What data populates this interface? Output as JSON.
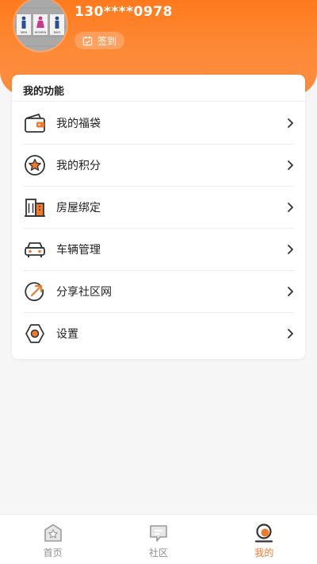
{
  "header": {
    "phone": "130****0978",
    "signin_label": "签到",
    "avatar_signs": [
      "MEN",
      "WOMEN",
      "DIKO"
    ]
  },
  "functions": {
    "title": "我的功能",
    "items": [
      {
        "label": "我的福袋",
        "icon": "wallet-icon"
      },
      {
        "label": "我的积分",
        "icon": "star-badge-icon"
      },
      {
        "label": "房屋绑定",
        "icon": "building-icon"
      },
      {
        "label": "车辆管理",
        "icon": "car-icon"
      },
      {
        "label": "分享社区网",
        "icon": "share-icon"
      },
      {
        "label": "设置",
        "icon": "settings-icon"
      }
    ]
  },
  "nav": {
    "items": [
      {
        "label": "首页",
        "icon": "home-icon",
        "active": false
      },
      {
        "label": "社区",
        "icon": "chat-icon",
        "active": false
      },
      {
        "label": "我的",
        "icon": "profile-icon",
        "active": true
      }
    ]
  },
  "colors": {
    "accent": "#ef7a2b",
    "header_top": "#ff7a1d",
    "header_bottom": "#fb8c40",
    "inactive": "#8f8f8f"
  }
}
